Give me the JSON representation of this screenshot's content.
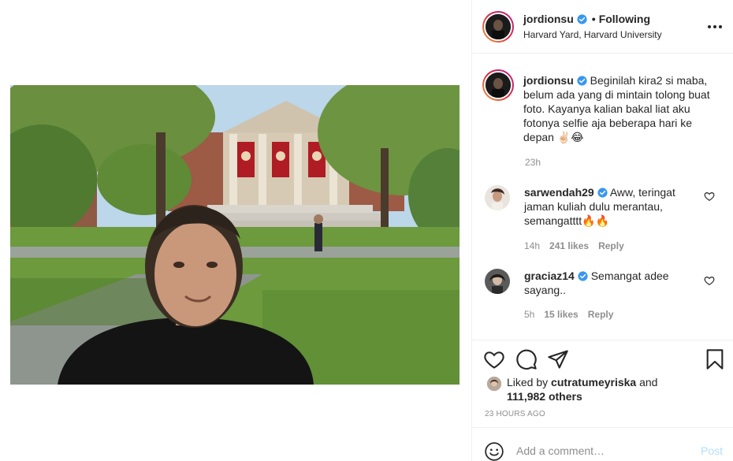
{
  "post": {
    "username": "jordionsu",
    "following_label": "Following",
    "location": "Harvard Yard, Harvard University",
    "photo_alt": "Selfie in Harvard Yard"
  },
  "caption": {
    "username": "jordionsu",
    "text": "Beginilah kira2 si maba, belum ada yang di mintain tolong buat foto. Kayanya kalian bakal liat aku fotonya selfie aja beberapa hari ke depan ✌🏻😂",
    "time": "23h"
  },
  "comments": [
    {
      "username": "sarwendah29",
      "text": "Aww, teringat jaman kuliah dulu merantau, semangatttt🔥🔥",
      "time": "14h",
      "likes": "241 likes",
      "reply": "Reply",
      "verified": true
    },
    {
      "username": "graciaz14",
      "text": "Semangat adee sayang..",
      "time": "5h",
      "likes": "15 likes",
      "reply": "Reply",
      "verified": true
    }
  ],
  "likes": {
    "prefix": "Liked by",
    "user": "cutratumeyriska",
    "middle": "and",
    "others": "111,982 others"
  },
  "timestamp": "23 HOURS AGO",
  "add_comment": {
    "placeholder": "Add a comment…",
    "post_label": "Post"
  },
  "colors": {
    "verified_blue": "#3897f0",
    "post_disabled": "#b2dffc",
    "secondary_text": "#8e8e8e",
    "primary_text": "#262626"
  },
  "icons": {
    "header_more": "more-horizontal-icon",
    "like": "heart-icon",
    "comment": "comment-bubble-icon",
    "share": "paper-plane-icon",
    "save": "bookmark-icon",
    "emoji": "smiley-icon"
  }
}
